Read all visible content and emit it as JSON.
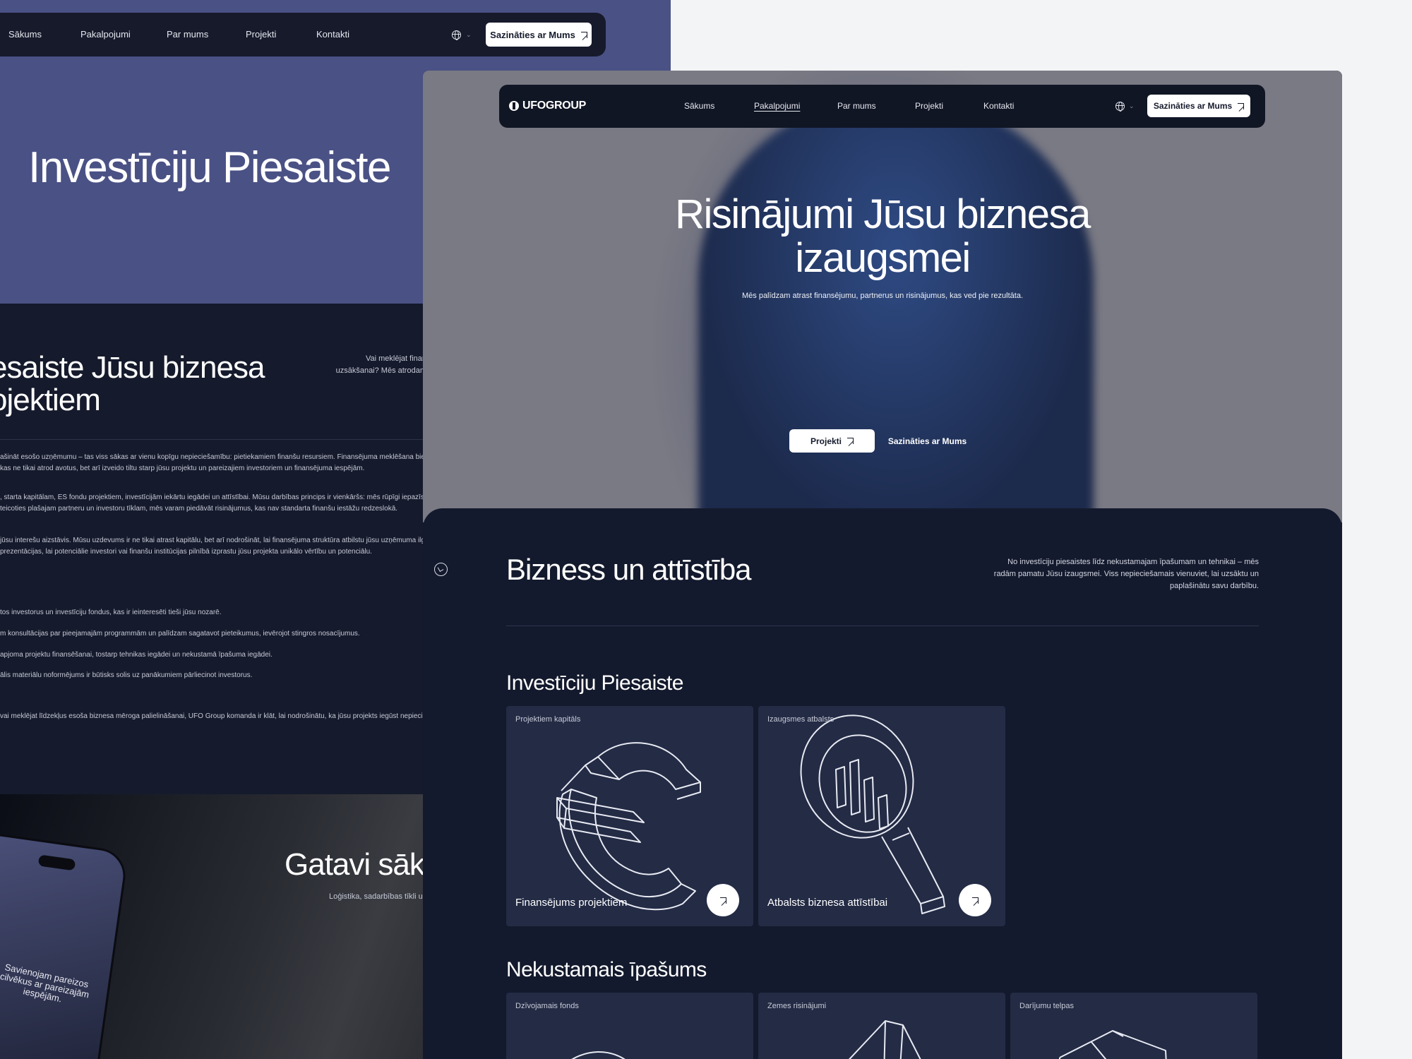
{
  "back_page": {
    "nav": {
      "links": [
        "Sākums",
        "Pakalpojumi",
        "Par mums",
        "Projekti",
        "Kontakti"
      ],
      "cta_label": "Sazināties ar Mums"
    },
    "hero_title": "Investīciju Piesaiste",
    "section_title": "esaiste Jūsu biznesa ojektiem",
    "section_intro": "Vai meklējat finan uzsākšanai? Mēs atrodam",
    "paragraphs": [
      "ašināt esošo uzņēmumu – tas viss sākas ar vienu kopīgu nepieciešamību: pietiekamiem finanšu resursiem. Finansējuma meklēšana bieži vien va",
      "kas ne tikai atrod avotus, bet arī izveido tiltu starp jūsu projektu un pareizajiem investoriem un finansējuma iespējām.",
      ", starta kapitālam, ES fondu projektiem, investīcijām iekārtu iegādei un attīstībai. Mūsu darbības princips ir vienkāršs: mēs rūpīgi iepazīstamies ar",
      "teicoties plašajam partneru un investoru tīklam, mēs varam piedāvāt risinājumus, kas nav standarta finanšu iestāžu redzeslokā.",
      "jūsu interešu aizstāvis. Mūsu uzdevums ir ne tikai atrast kapitālu, bet arī nodrošināt, lai finansējuma struktūra atbilstu jūsu uzņēmuma ilgtermiņa",
      "prezentācijas, lai potenciālie investori vai finanšu institūcijas pilnībā izprastu jūsu projekta unikālo vērtību un potenciālu.",
      "tos investorus un investīciju fondus, kas ir ieinteresēti tieši jūsu nozarē.",
      "m konsultācijas par pieejamajām programmām un palīdzam sagatavot pieteikumus, ievērojot stingros nosacījumus.",
      "apjoma projektu finansēšanai, tostarp tehnikas iegādei un nekustamā īpašuma iegādei.",
      "ālis materiālu noformējums ir būtisks solis uz panākumiem pārliecinot investorus.",
      "vai meklējat līdzekļus esoša biznesa mēroga palielināšanai, UFO Group komanda ir klāt, lai nodrošinātu, ka jūsu projekts iegūst nepieciešamo atb"
    ],
    "cta_section_title": "Gatavi sāk",
    "cta_section_sub": "Loģistika, sadarbības tīkli un",
    "phone_text": "Savienojam pareizos cilvēkus ar pareizajām iespējām."
  },
  "front_page": {
    "logo": "UFOGROUP",
    "nav": {
      "links": [
        "Sākums",
        "Pakalpojumi",
        "Par mums",
        "Projekti",
        "Kontakti"
      ],
      "active": "Pakalpojumi",
      "cta_label": "Sazināties ar Mums"
    },
    "hero": {
      "title_line1": "Risinājumi Jūsu biznesa",
      "title_line2": "izaugsmei",
      "subtitle": "Mēs palīdzam atrast finansējumu, partnerus un risinājumus, kas ved pie rezultāta.",
      "primary_button": "Projekti",
      "secondary_button": "Sazināties ar Mums"
    },
    "section": {
      "title": "Bizness un attīstība",
      "description": "No investīciju piesaistes līdz nekustamajam īpašumam un tehnikai – mēs radām pamatu Jūsu izaugsmei. Viss nepieciešamais vienuviet, lai uzsāktu un paplašinātu savu darbību."
    },
    "categories": [
      {
        "heading": "Investīciju Piesaiste",
        "cards": [
          {
            "tag": "Projektiem kapitāls",
            "title": "Finansējums projektiem",
            "icon": "euro-icon"
          },
          {
            "tag": "Izaugsmes atbalsts",
            "title": "Atbalsts biznesa attīstībai",
            "icon": "magnifier-chart-icon"
          }
        ]
      },
      {
        "heading": "Nekustamais īpašums",
        "cards": [
          {
            "tag": "Dzīvojamais fonds"
          },
          {
            "tag": "Zemes risinājumi"
          },
          {
            "tag": "Darījumu telpas"
          }
        ]
      }
    ]
  },
  "colors": {
    "navy": "#141a2d",
    "card": "#232b45",
    "hero_blue": "#4a5185",
    "white": "#ffffff"
  }
}
